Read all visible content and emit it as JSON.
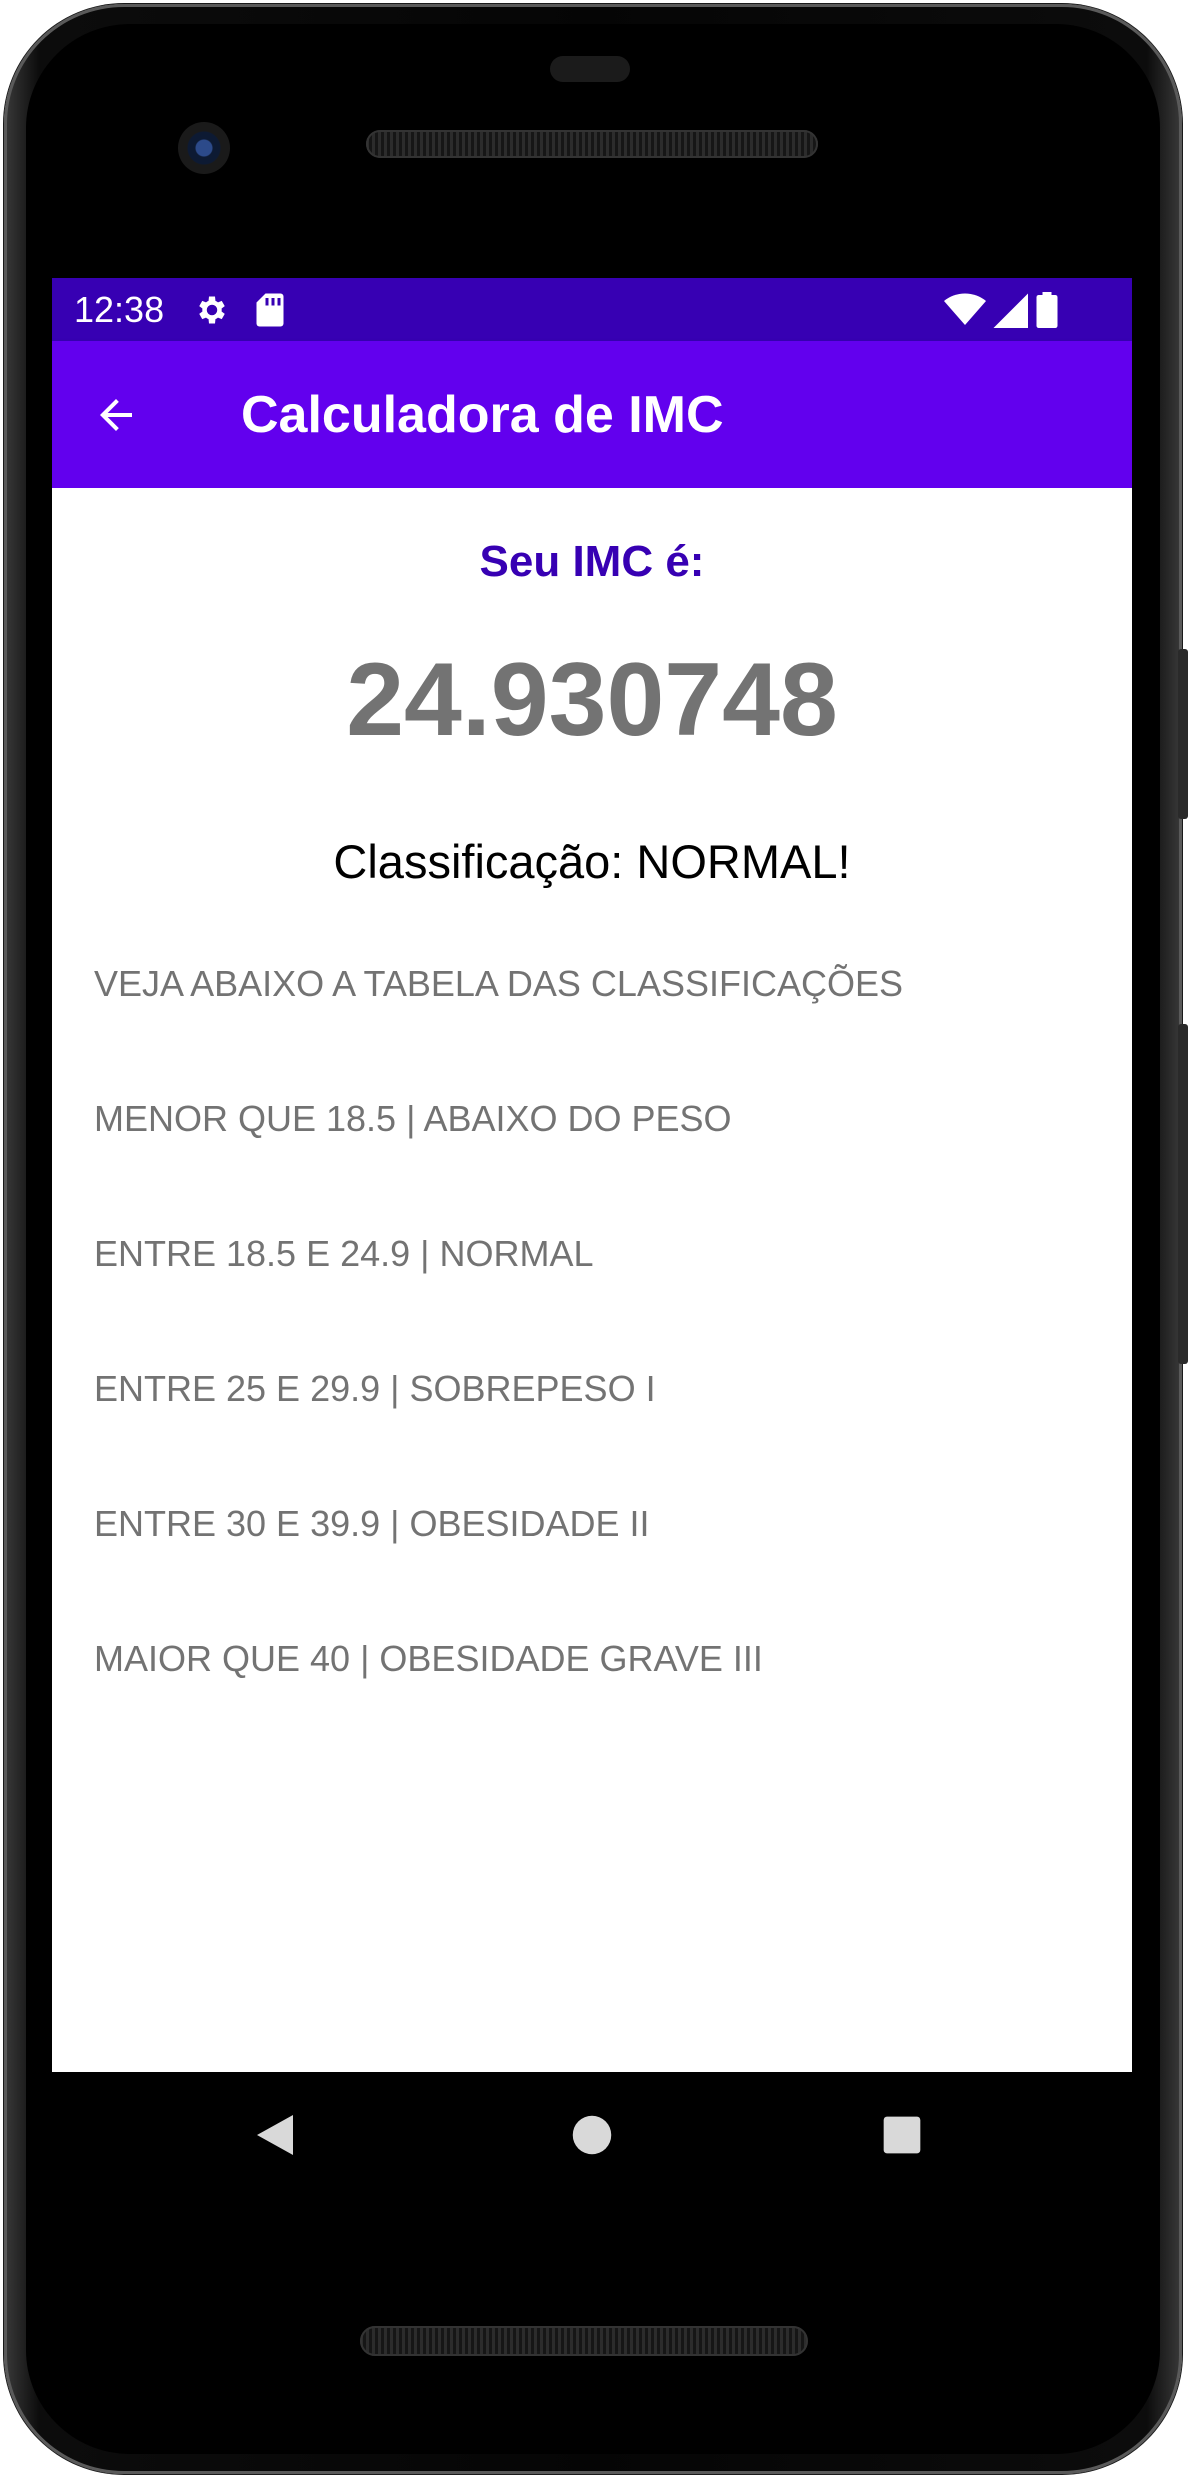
{
  "status_bar": {
    "time": "12:38",
    "background": "#3700b3",
    "icons": [
      "settings-icon",
      "sd-card-icon",
      "wifi-icon",
      "signal-icon",
      "battery-icon"
    ]
  },
  "app_bar": {
    "title": "Calculadora de IMC",
    "background": "#6200ee",
    "back_icon": "arrow-back-icon"
  },
  "result": {
    "label": "Seu IMC é:",
    "value": "24.930748",
    "classification": "Classificação: NORMAL!",
    "label_color": "#3700b3",
    "value_color": "#737373"
  },
  "table": {
    "heading": "VEJA ABAIXO A TABELA DAS CLASSIFICAÇÕES",
    "rows": [
      "MENOR QUE 18.5 | ABAIXO DO PESO",
      "ENTRE 18.5 E 24.9 | NORMAL",
      "ENTRE 25 E 29.9 | SOBREPESO I",
      "ENTRE 30 E 39.9 | OBESIDADE II",
      "MAIOR QUE 40 | OBESIDADE GRAVE III"
    ]
  },
  "navigation": {
    "icons": [
      "nav-back-icon",
      "nav-home-icon",
      "nav-recents-icon"
    ]
  }
}
